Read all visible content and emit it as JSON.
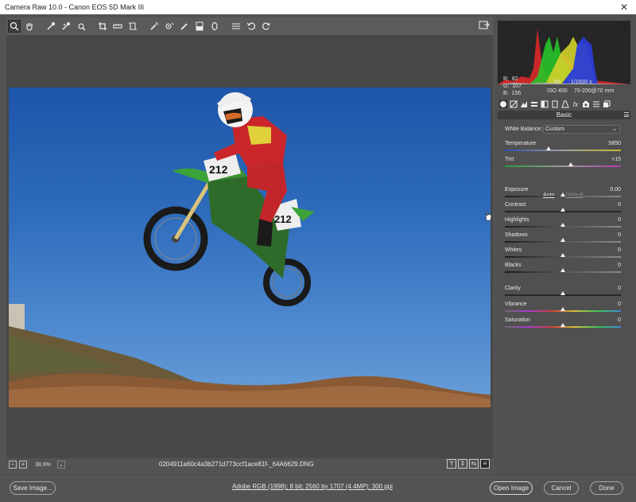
{
  "window": {
    "title": "Camera Raw 10.0  -  Canon EOS 5D Mark III",
    "close": "✕"
  },
  "toolbar": {
    "tools": [
      "zoom",
      "hand",
      "white-balance",
      "color-sampler",
      "targeted-adjustment",
      "crop",
      "straighten",
      "transform",
      "spot-removal",
      "red-eye",
      "adjustment-brush",
      "graduated-filter",
      "radial-filter",
      "preferences",
      "rotate-ccw",
      "rotate-cw"
    ]
  },
  "histogram": {
    "rgb": {
      "r_label": "R:",
      "r": "82",
      "g_label": "G:",
      "g": "107",
      "b_label": "B:",
      "b": "156"
    },
    "camera": {
      "aperture": "f/8",
      "shutter": "1/1600 s",
      "iso": "ISO 400",
      "lens": "70-200@70 mm"
    }
  },
  "panel": {
    "section_title": "Basic",
    "white_balance_label": "White Balance:",
    "white_balance_value": "Custom",
    "auto_label": "Auto",
    "default_label": "Default",
    "controls": {
      "temperature": {
        "label": "Temperature",
        "value": "5850",
        "position": 0.38
      },
      "tint": {
        "label": "Tint",
        "value": "+15",
        "position": 0.57
      },
      "exposure": {
        "label": "Exposure",
        "value": "0.00",
        "position": 0.5
      },
      "contrast": {
        "label": "Contrast",
        "value": "0",
        "position": 0.5
      },
      "highlights": {
        "label": "Highlights",
        "value": "0",
        "position": 0.5
      },
      "shadows": {
        "label": "Shadows",
        "value": "0",
        "position": 0.5
      },
      "whites": {
        "label": "Whites",
        "value": "0",
        "position": 0.5
      },
      "blacks": {
        "label": "Blacks",
        "value": "0",
        "position": 0.5
      },
      "clarity": {
        "label": "Clarity",
        "value": "0",
        "position": 0.5
      },
      "vibrance": {
        "label": "Vibrance",
        "value": "0",
        "position": 0.5
      },
      "saturation": {
        "label": "Saturation",
        "value": "0",
        "position": 0.5
      }
    }
  },
  "status": {
    "zoom_out": "−",
    "zoom_in": "+",
    "zoom": "38.9%",
    "filename": "0204911a60c4a3b271d773ccf1ace81f-_64A6629.DNG"
  },
  "bottom": {
    "save_image": "Save Image...",
    "workflow": "Adobe RGB (1998); 8 bit; 2560 by 1707 (4.4MP); 300 ppi",
    "open_image": "Open Image",
    "cancel": "Cancel",
    "done": "Done"
  },
  "photo": {
    "number_plate": "212"
  }
}
